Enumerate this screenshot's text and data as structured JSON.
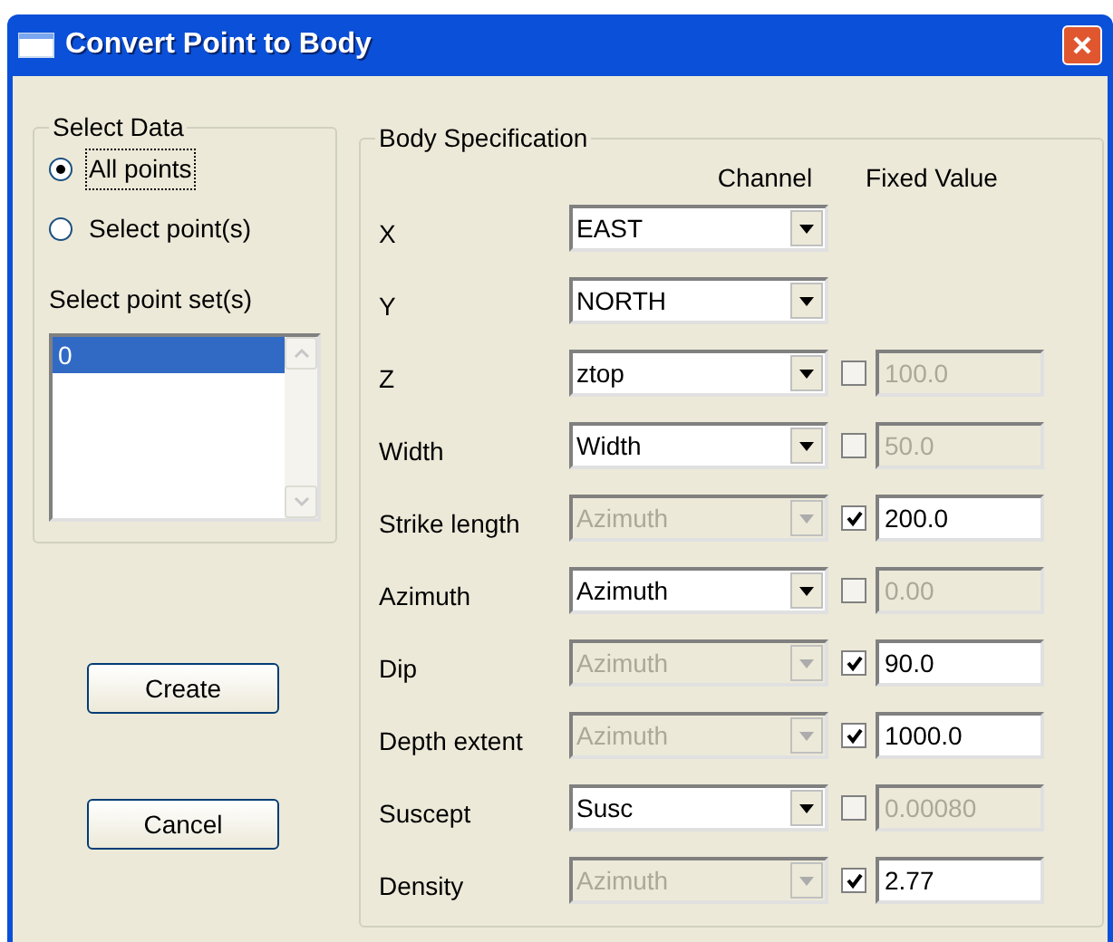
{
  "window": {
    "title": "Convert Point to Body"
  },
  "select_data": {
    "title": "Select Data",
    "options": [
      {
        "label": "All points",
        "selected": true
      },
      {
        "label": "Select point(s)",
        "selected": false
      }
    ],
    "point_set_label": "Select point set(s)",
    "point_sets": [
      {
        "label": "0",
        "selected": true
      }
    ]
  },
  "buttons": [
    {
      "label": "Create"
    },
    {
      "label": "Cancel"
    }
  ],
  "body_specification": {
    "title": "Body Specification",
    "columns": [
      "Channel",
      "Fixed Value"
    ],
    "rows": [
      {
        "kind": "channel",
        "label": "X",
        "channel": "EAST"
      },
      {
        "kind": "channel",
        "label": "Y",
        "channel": "NORTH"
      },
      {
        "kind": "fixed",
        "label": "Z",
        "channel": "ztop",
        "checked": false,
        "value": "100.0"
      },
      {
        "kind": "fixed",
        "label": "Width",
        "channel": "Width",
        "checked": false,
        "value": "50.0"
      },
      {
        "kind": "fixed",
        "label": "Strike length",
        "channel": "Azimuth",
        "checked": true,
        "value": "200.0"
      },
      {
        "kind": "fixed",
        "label": "Azimuth",
        "channel": "Azimuth",
        "checked": false,
        "value": "0.00"
      },
      {
        "kind": "fixed",
        "label": "Dip",
        "channel": "Azimuth",
        "checked": true,
        "value": "90.0"
      },
      {
        "kind": "fixed",
        "label": "Depth extent",
        "channel": "Azimuth",
        "checked": true,
        "value": "1000.0"
      },
      {
        "kind": "fixed",
        "label": "Suscept",
        "channel": "Susc",
        "checked": false,
        "value": "0.00080"
      },
      {
        "kind": "fixed",
        "label": "Density",
        "channel": "Azimuth",
        "checked": true,
        "value": "2.77"
      }
    ]
  }
}
